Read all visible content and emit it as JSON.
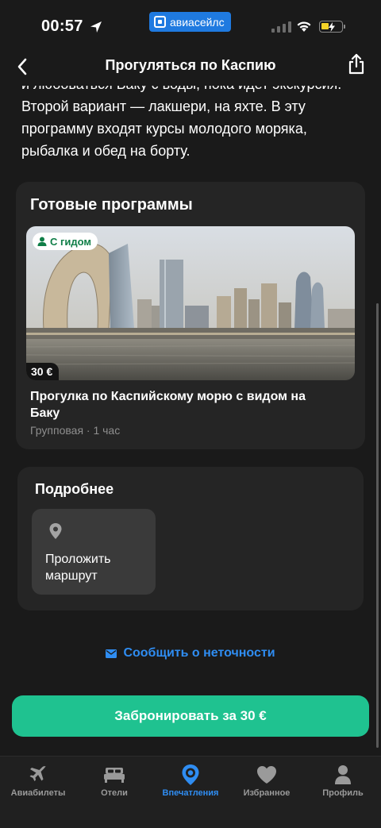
{
  "status": {
    "time": "00:57",
    "app_pill": "авиасейлс"
  },
  "nav": {
    "title": "Прогуляться по Каспию",
    "back_icon": "chevron-left-icon",
    "share_icon": "share-icon"
  },
  "intro": {
    "text": "и любоваться Баку с воды, пока идет экскурсия. Второй вариант — лакшери, на яхте. В эту программу входят курсы молодого моряка, рыбалка и обед на борту."
  },
  "programs": {
    "title": "Готовые программы",
    "items": [
      {
        "badge": "С гидом",
        "price": "30 €",
        "name": "Прогулка по Каспийскому морю с видом на Баку",
        "meta": "Групповая · 1 час"
      }
    ]
  },
  "more": {
    "title": "Подробнее",
    "route_label": "Проложить маршрут"
  },
  "report": {
    "label": "Сообщить о неточности"
  },
  "booking": {
    "label": "Забронировать за 30 €"
  },
  "tabs": [
    {
      "label": "Авиабилеты",
      "icon": "plane-icon",
      "active": false
    },
    {
      "label": "Отели",
      "icon": "bed-icon",
      "active": false
    },
    {
      "label": "Впечатления",
      "icon": "location-pin-icon",
      "active": true
    },
    {
      "label": "Избранное",
      "icon": "heart-icon",
      "active": false
    },
    {
      "label": "Профиль",
      "icon": "person-icon",
      "active": false
    }
  ],
  "colors": {
    "accent": "#2f8df2",
    "book_button": "#1fc290",
    "background": "#1a1a1a",
    "card": "#252525"
  }
}
